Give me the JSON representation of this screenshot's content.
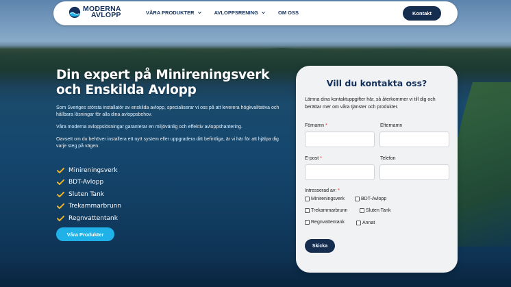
{
  "brand": {
    "logo_line1": "MODERNA",
    "logo_line2": "AVLOPP",
    "logo_icon": "drop-wave-logo",
    "primary": "#152d4f",
    "accent": "#1fb1e8",
    "check": "#f2b425"
  },
  "nav": {
    "items": [
      {
        "label": "VÅRA PRODUKTER",
        "has_dropdown": true
      },
      {
        "label": "AVLOPPSRENING",
        "has_dropdown": true
      },
      {
        "label": "OM OSS",
        "has_dropdown": false
      }
    ],
    "contact_label": "Kontakt"
  },
  "hero": {
    "title_line1": "Din expert på Minireningsverk",
    "title_line2": "och Enskilda Avlopp",
    "paragraph1": "Som Sveriges största installatör av enskilda avlopp, specialiserar vi oss på att leverera högkvalitativa och hållbara lösningar för alla dina avloppsbehov.",
    "paragraph2": "Våra moderna avloppslösningar garanterar en miljövänlig och effektiv avloppshantering.",
    "paragraph3": "Oavsett om du behöver installera ett nytt system eller uppgradera ditt befintliga, är vi här för att hjälpa dig varje steg på vägen.",
    "checklist": [
      "Minireningsverk",
      "BDT-Avlopp",
      "Sluten Tank",
      "Trekammarbrunn",
      "Regnvattentank"
    ],
    "button_label": "Våra Produkter"
  },
  "form": {
    "title": "Vill du kontakta oss?",
    "intro": "Lämna dina kontaktuppgifter här, så återkommer vi till dig och berättar mer om våra tjänster och produkter.",
    "first_name_label": "Förnamn",
    "last_name_label": "Efternamn",
    "email_label": "E-post",
    "phone_label": "Telefon",
    "interest_label": "Intresserad av:",
    "required_mark": "*",
    "options": [
      "Minireningsverk",
      "BDT-Avlopp",
      "Trekammarbrunn",
      "Sluten Tank",
      "Regnvattentank",
      "Annat"
    ],
    "submit_label": "Skicka"
  }
}
